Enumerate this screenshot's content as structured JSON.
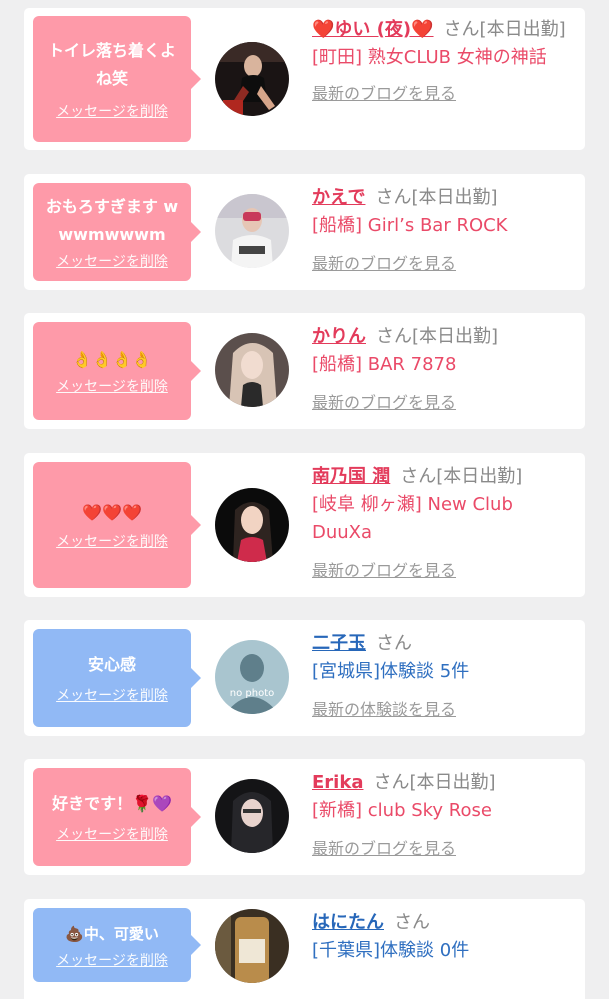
{
  "cards": [
    {
      "message": "トイレ落ち着くよね笑",
      "delete_label": "メッセージを削除",
      "name": "❤️ゆい (夜)❤️",
      "honorific": "さん",
      "status": "[本日出勤]",
      "shop": "[町田] 熟女CLUB 女神の神話",
      "more_label": "最新のブログを見る",
      "bubble_color": "#fe9aa9"
    },
    {
      "message": "おもろすぎます wwwmwwwm",
      "delete_label": "メッセージを削除",
      "name": "かえで",
      "honorific": "さん",
      "status": "[本日出勤]",
      "shop": "[船橋] Girl’s Bar ROCK",
      "more_label": "最新のブログを見る",
      "bubble_color": "#fe9aa9"
    },
    {
      "message": "👌👌👌👌",
      "delete_label": "メッセージを削除",
      "name": "かりん",
      "honorific": "さん",
      "status": "[本日出勤]",
      "shop": "[船橋] BAR 7878",
      "more_label": "最新のブログを見る",
      "bubble_color": "#fe9aa9"
    },
    {
      "message": "❤️❤️❤️",
      "delete_label": "メッセージを削除",
      "name": "南乃国 潤",
      "honorific": "さん",
      "status": "[本日出勤]",
      "shop": "[岐阜 柳ヶ瀬] New Club DuuXa",
      "more_label": "最新のブログを見る",
      "bubble_color": "#fe9aa9"
    },
    {
      "message": "安心感",
      "delete_label": "メッセージを削除",
      "name": "二子玉",
      "honorific": "さん",
      "status": "",
      "shop": "[宮城県]体験談 5件",
      "more_label": "最新の体験談を見る",
      "avatar_text": "no photo",
      "bubble_color": "#91b9f5"
    },
    {
      "message": "好きです！🌹💜",
      "delete_label": "メッセージを削除",
      "name": "Erika",
      "honorific": "さん",
      "status": "[本日出勤]",
      "shop": "[新橋] club Sky Rose",
      "more_label": "最新のブログを見る",
      "bubble_color": "#fe9aa9"
    },
    {
      "message": "💩中、可愛い",
      "delete_label": "メッセージを削除",
      "name": "はにたん",
      "honorific": "さん",
      "status": "",
      "shop": "[千葉県]体験談 0件",
      "more_label": "",
      "bubble_color": "#91b9f5"
    }
  ]
}
